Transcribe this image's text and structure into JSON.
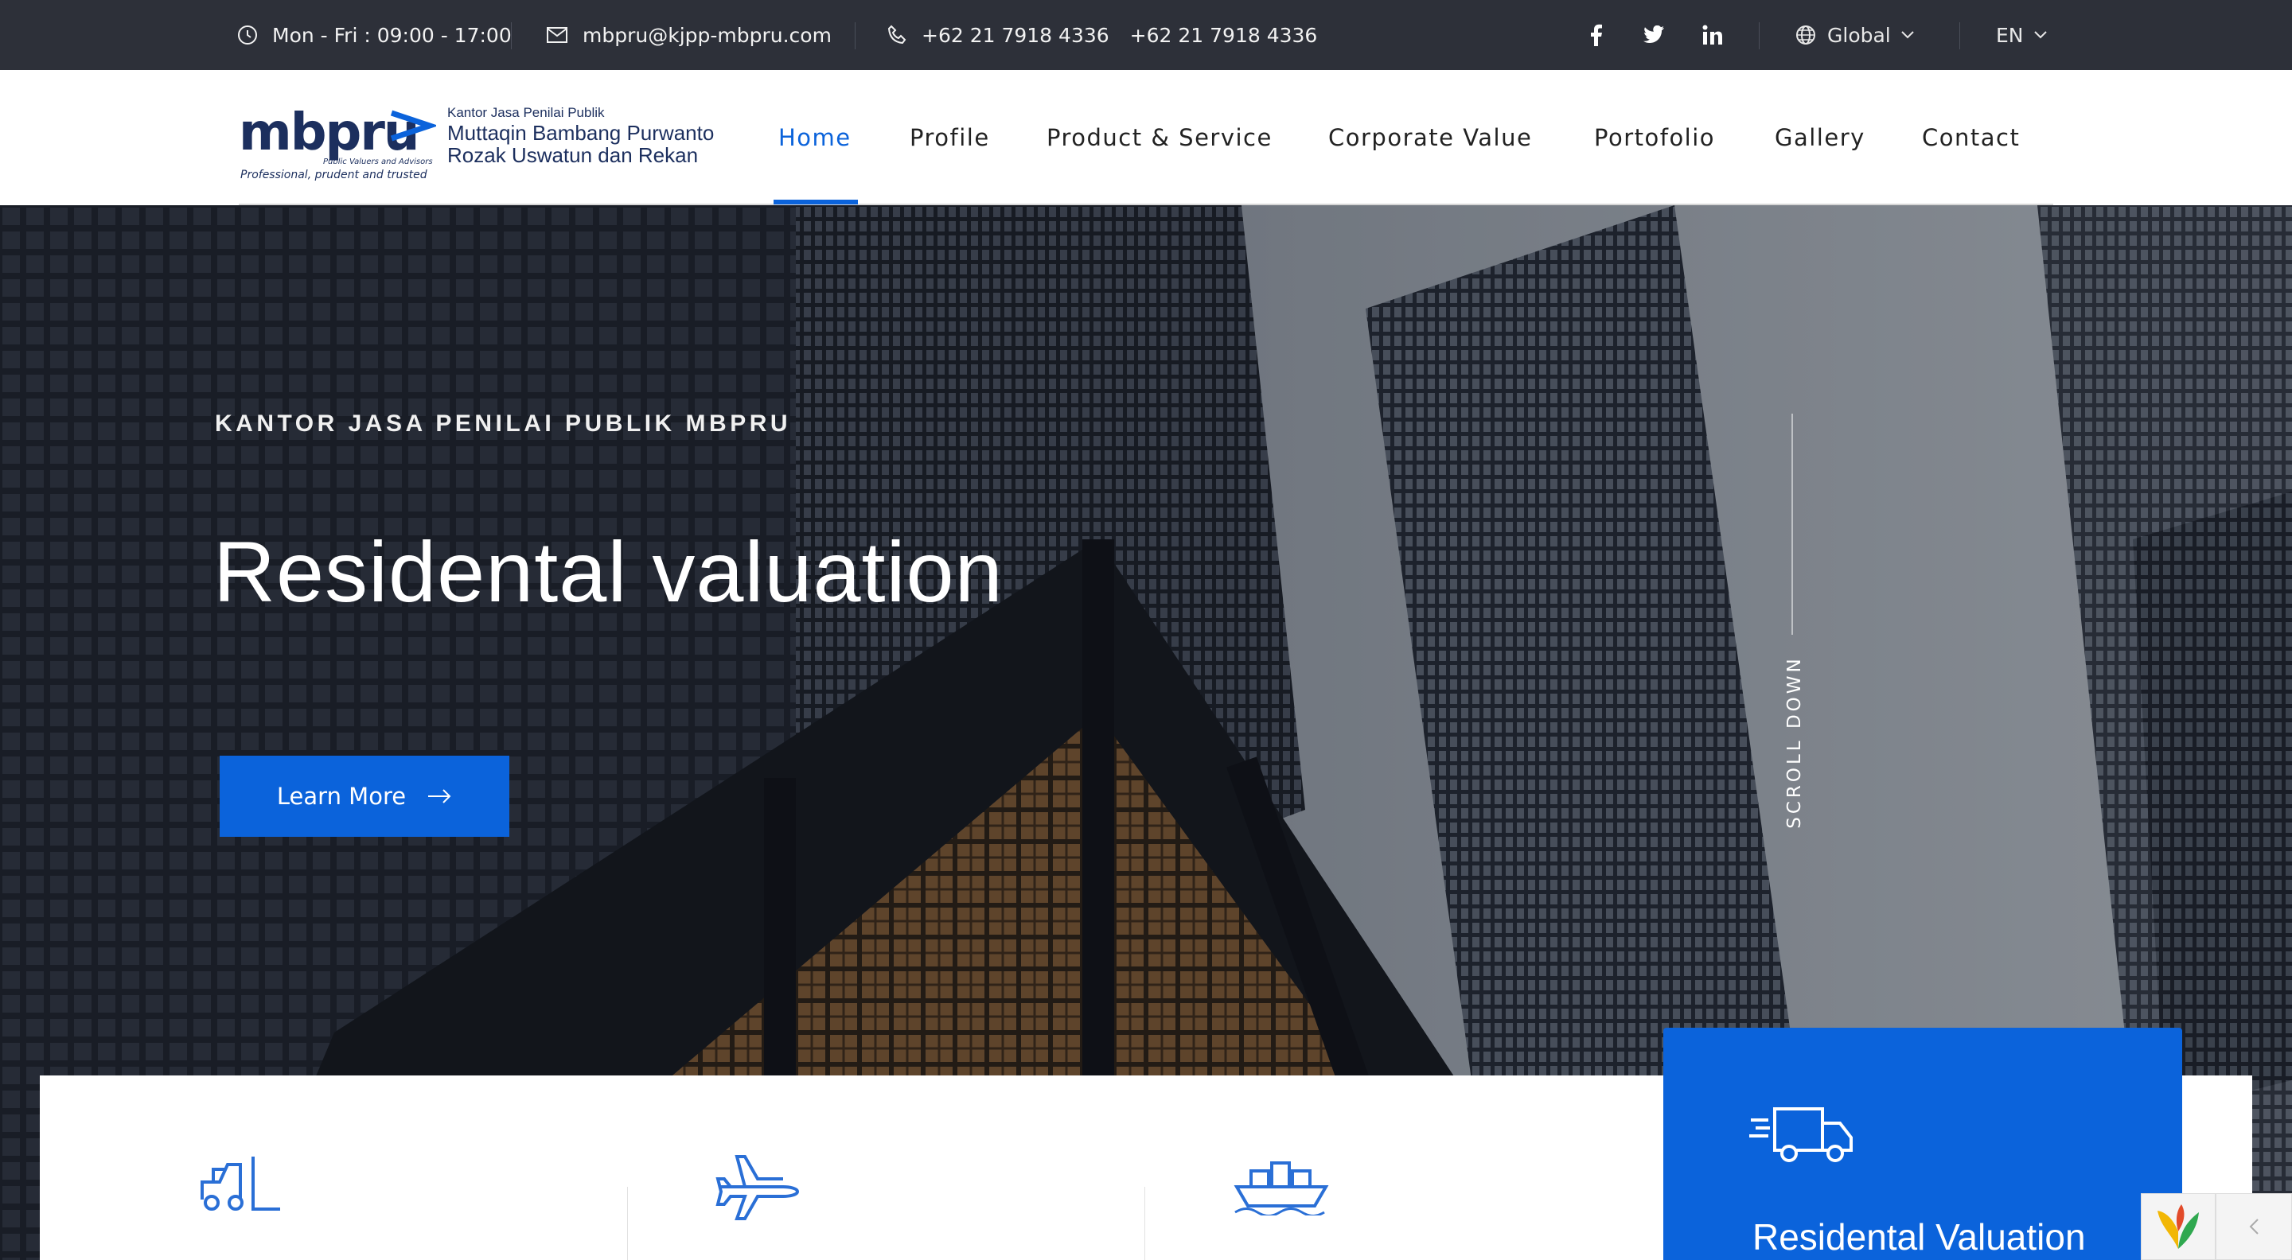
{
  "topbar": {
    "hours": "Mon - Fri : 09:00 - 17:00",
    "email": "mbpru@kjpp-mbpru.com",
    "phone1": "+62 21 7918 4336",
    "phone2": "+62 21 7918 4336",
    "social": [
      "facebook-icon",
      "twitter-icon",
      "linkedin-icon"
    ],
    "region": "Global",
    "language": "EN"
  },
  "logo": {
    "wordmark": "mbpru",
    "sub": "Public Valuers and Advisors",
    "tagline": "Professional, prudent and trusted",
    "firm_kind": "Kantor Jasa Penilai Publik",
    "firm_name_1": "Muttaqin Bambang Purwanto",
    "firm_name_2": "Rozak Uswatun dan Rekan"
  },
  "nav": {
    "items": [
      "Home",
      "Profile",
      "Product & Service",
      "Corporate Value",
      "Portofolio",
      "Gallery",
      "Contact"
    ],
    "active": "Home"
  },
  "hero": {
    "kicker": "KANTOR JASA PENILAI PUBLIK MBPRU",
    "title": "Residental valuation",
    "cta": "Learn More",
    "scroll_hint": "SCROLL DOWN"
  },
  "services": {
    "icons": [
      "forklift-icon",
      "airplane-icon",
      "cargo-ship-icon",
      "delivery-truck-icon"
    ],
    "featured_title": "Residental Valuation"
  },
  "colors": {
    "topbar_bg": "#2d3039",
    "accent": "#0b63db",
    "brand_navy": "#1c2f5e"
  }
}
